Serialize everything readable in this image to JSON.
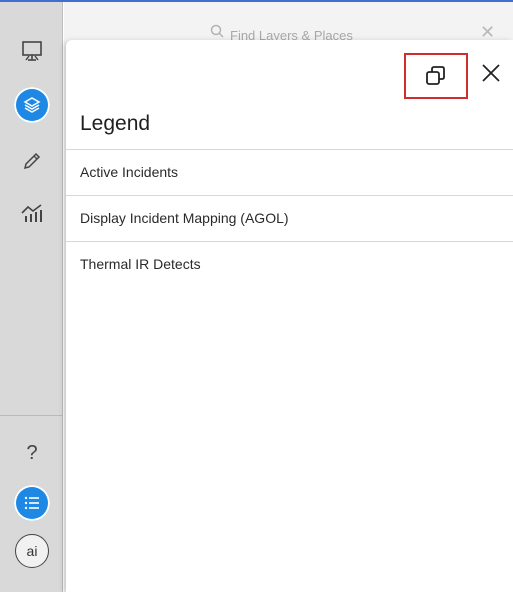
{
  "toolbar": {
    "help_label": "?",
    "ai_label": "ai"
  },
  "search": {
    "placeholder": "Find Layers & Places"
  },
  "legend_panel": {
    "title": "Legend",
    "layers": [
      {
        "label": "Active Incidents"
      },
      {
        "label": "Display Incident Mapping (AGOL)"
      },
      {
        "label": "Thermal IR Detects"
      }
    ]
  },
  "colors": {
    "accent": "#1e88e5",
    "highlight_box": "#d12d2d",
    "sidebar_bg": "#d9d9d9",
    "top_border": "#3f6fd1"
  },
  "icons": [
    "presentation-icon",
    "layers-icon",
    "pencil-icon",
    "analysis-icon",
    "help-icon",
    "legend-list-icon",
    "ai-icon",
    "search-icon",
    "dock-window-icon",
    "close-icon"
  ]
}
